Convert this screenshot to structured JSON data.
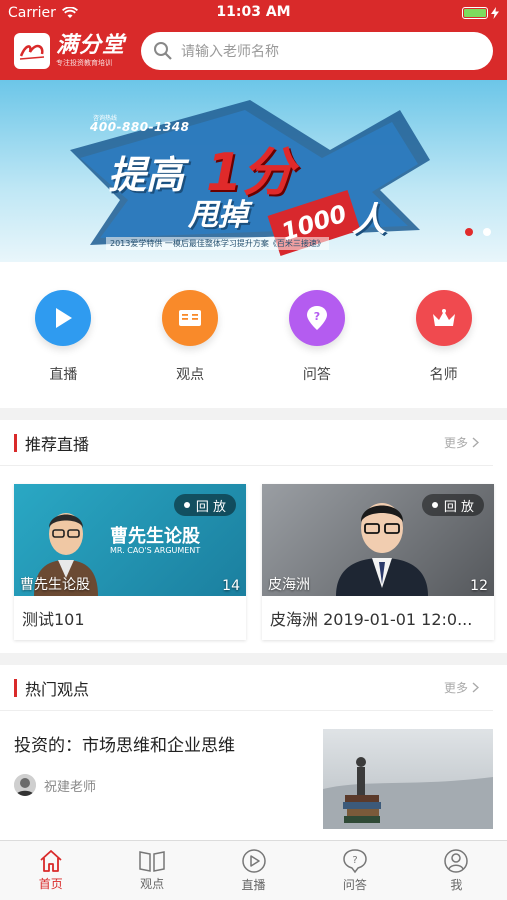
{
  "status_bar": {
    "carrier": "Carrier",
    "time": "11:03 AM"
  },
  "header": {
    "logo_title": "满分堂",
    "logo_subtitle": "专注投资教育培训",
    "search_placeholder": "请输入老师名称"
  },
  "banner": {
    "phone_label": "咨询热线",
    "phone": "400-880-1348",
    "line1": "提高",
    "big": "1分",
    "line2": "甩掉",
    "badge": "1000",
    "ren": "人",
    "subtitle": "2013爱学特供   一模后最佳整体学习提升方案《百米三接速》",
    "active_dot": 0
  },
  "quick_entries": [
    {
      "label": "直播",
      "icon": "play-icon",
      "color": "#2f9bf0"
    },
    {
      "label": "观点",
      "icon": "book-icon",
      "color": "#f98a2a"
    },
    {
      "label": "问答",
      "icon": "question-icon",
      "color": "#b45cf0"
    },
    {
      "label": "名师",
      "icon": "crown-icon",
      "color": "#f04a4f"
    }
  ],
  "live_section": {
    "title": "推荐直播",
    "more": "更多",
    "cards": [
      {
        "badge": "回 放",
        "name": "曹先生论股",
        "count": "14",
        "title": "测试101",
        "brand": "曹先生论股",
        "brand_sub": "MR. CAO'S ARGUMENT"
      },
      {
        "badge": "回 放",
        "name": "皮海洲",
        "count": "12",
        "title": "皮海洲 2019-01-01 12:0..."
      }
    ]
  },
  "views_section": {
    "title": "热门观点",
    "more": "更多",
    "articles": [
      {
        "title": "投资的：市场思维和企业思维",
        "author": "祝建老师"
      }
    ]
  },
  "tabbar": [
    {
      "label": "首页",
      "icon": "home-icon",
      "active": true
    },
    {
      "label": "观点",
      "icon": "book-open-icon",
      "active": false
    },
    {
      "label": "直播",
      "icon": "play-circle-icon",
      "active": false
    },
    {
      "label": "问答",
      "icon": "question-bubble-icon",
      "active": false
    },
    {
      "label": "我",
      "icon": "user-icon",
      "active": false
    }
  ],
  "colors": {
    "brand": "#d92a2a"
  }
}
